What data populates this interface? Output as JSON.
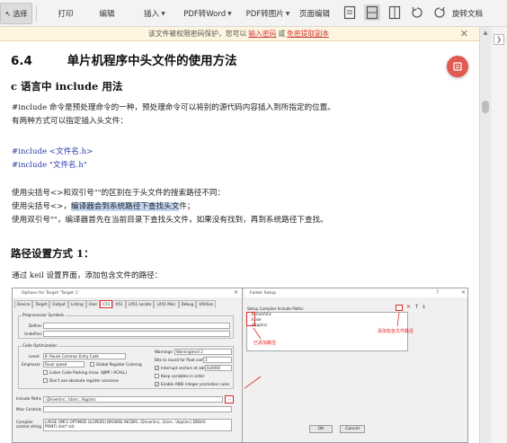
{
  "toolbar": {
    "select_label": "选择",
    "print_label": "打印",
    "edit_label": "编辑",
    "insert_label": "插入",
    "pdf_to_word_label": "PDF转Word",
    "pdf_to_image_label": "PDF转图片",
    "page_edit_label": "页面编辑",
    "rotate_label": "旋转文档"
  },
  "notice": {
    "text": "该文件被权限密码保护，您可以",
    "link1": "输入密码",
    "mid": "或",
    "link2": "免密提取副本"
  },
  "doc": {
    "section_num": "6.4",
    "section_title": "单片机程序中头文件的使用方法",
    "sub1": "c 语言中 include 用法",
    "p1": "#include 命令是预处理命令的一种，预处理命令可以将别的源代码内容插入到所指定的位置。",
    "p2": "有两种方式可以指定插入头文件：",
    "code1": "#include <文件名.h>",
    "code2": "#include \"文件名.h\"",
    "p3": "使用尖括号<>和双引号\"\"的区别在于头文件的搜索路径不同：",
    "p4_pre": "使用尖括号<>，",
    "p4_hl": "编译器会到系统路径下查找头文",
    "p4_post": "件；",
    "p5": "使用双引号\"\"，编译器首先在当前目录下查找头文件，如果没有找到，再到系统路径下查找。",
    "sub2": "路径设置方式 1：",
    "p6": "通过 keil 设置界面，添加包含文件的路径："
  },
  "shot": {
    "win1_title": "Options for Target 'Target 1'",
    "tabs": [
      "Device",
      "Target",
      "Output",
      "Listing",
      "User",
      "C51",
      "A51",
      "LX51 Locate",
      "LX51 Misc",
      "Debug",
      "Utilities"
    ],
    "preproc_label": "Preprocessor Symbols",
    "define_label": "Define:",
    "undefine_label": "Undefine:",
    "codeopt_label": "Code Optimization",
    "level_label": "Level:",
    "level_value": "8: Reuse Common Entry Code",
    "emphasis_label": "Emphasis:",
    "emphasis_value": "Favor speed",
    "global_reg": "Global Register Coloring",
    "linker_packing": "Linker Code Packing (max. AJMP / ACALL)",
    "dont_abs": "Don't use absolute register accesses",
    "warnings_label": "Warnings:",
    "warnings_value": "Warninglevel 2",
    "bits_label": "Bits to round for float compare:",
    "bits_value": "3",
    "interrupt_label": "Interrupt vectors at address:",
    "interrupt_value": "0x0000",
    "keep_vars": "Keep variables in order",
    "enable_ansi": "Enable ANSI integer promotion rules",
    "include_label": "Include Paths",
    "include_value": ".\\Driver\\inc;..\\User;..\\App\\inc",
    "misc_label": "Misc Controls",
    "compiler_label": "Compiler control string",
    "compiler_value": "LARGE OMF2 OPTIMIZE (8,SPEED) BROWSE INCDIR(..\\Driver\\inc;..\\User;..\\App\\inc) DEBUG PRINT(.\\list\\*.lst)",
    "win2_title": "Folder Setup",
    "win2_help": "?",
    "setup_label": "Setup Compiler Include Paths:",
    "paths": [
      "..\\Driver\\inc",
      "..\\User",
      "..\\App\\inc"
    ],
    "ok_label": "OK",
    "cancel_label": "Cancel",
    "note_added": "已添加路径",
    "note_add": "添加包含文件路径"
  },
  "colors": {
    "accent_red": "#e02525",
    "link_red": "#d23c3c",
    "code_blue": "#2a3aa8",
    "highlight": "#c2d7f1",
    "fab": "#e05a50"
  }
}
